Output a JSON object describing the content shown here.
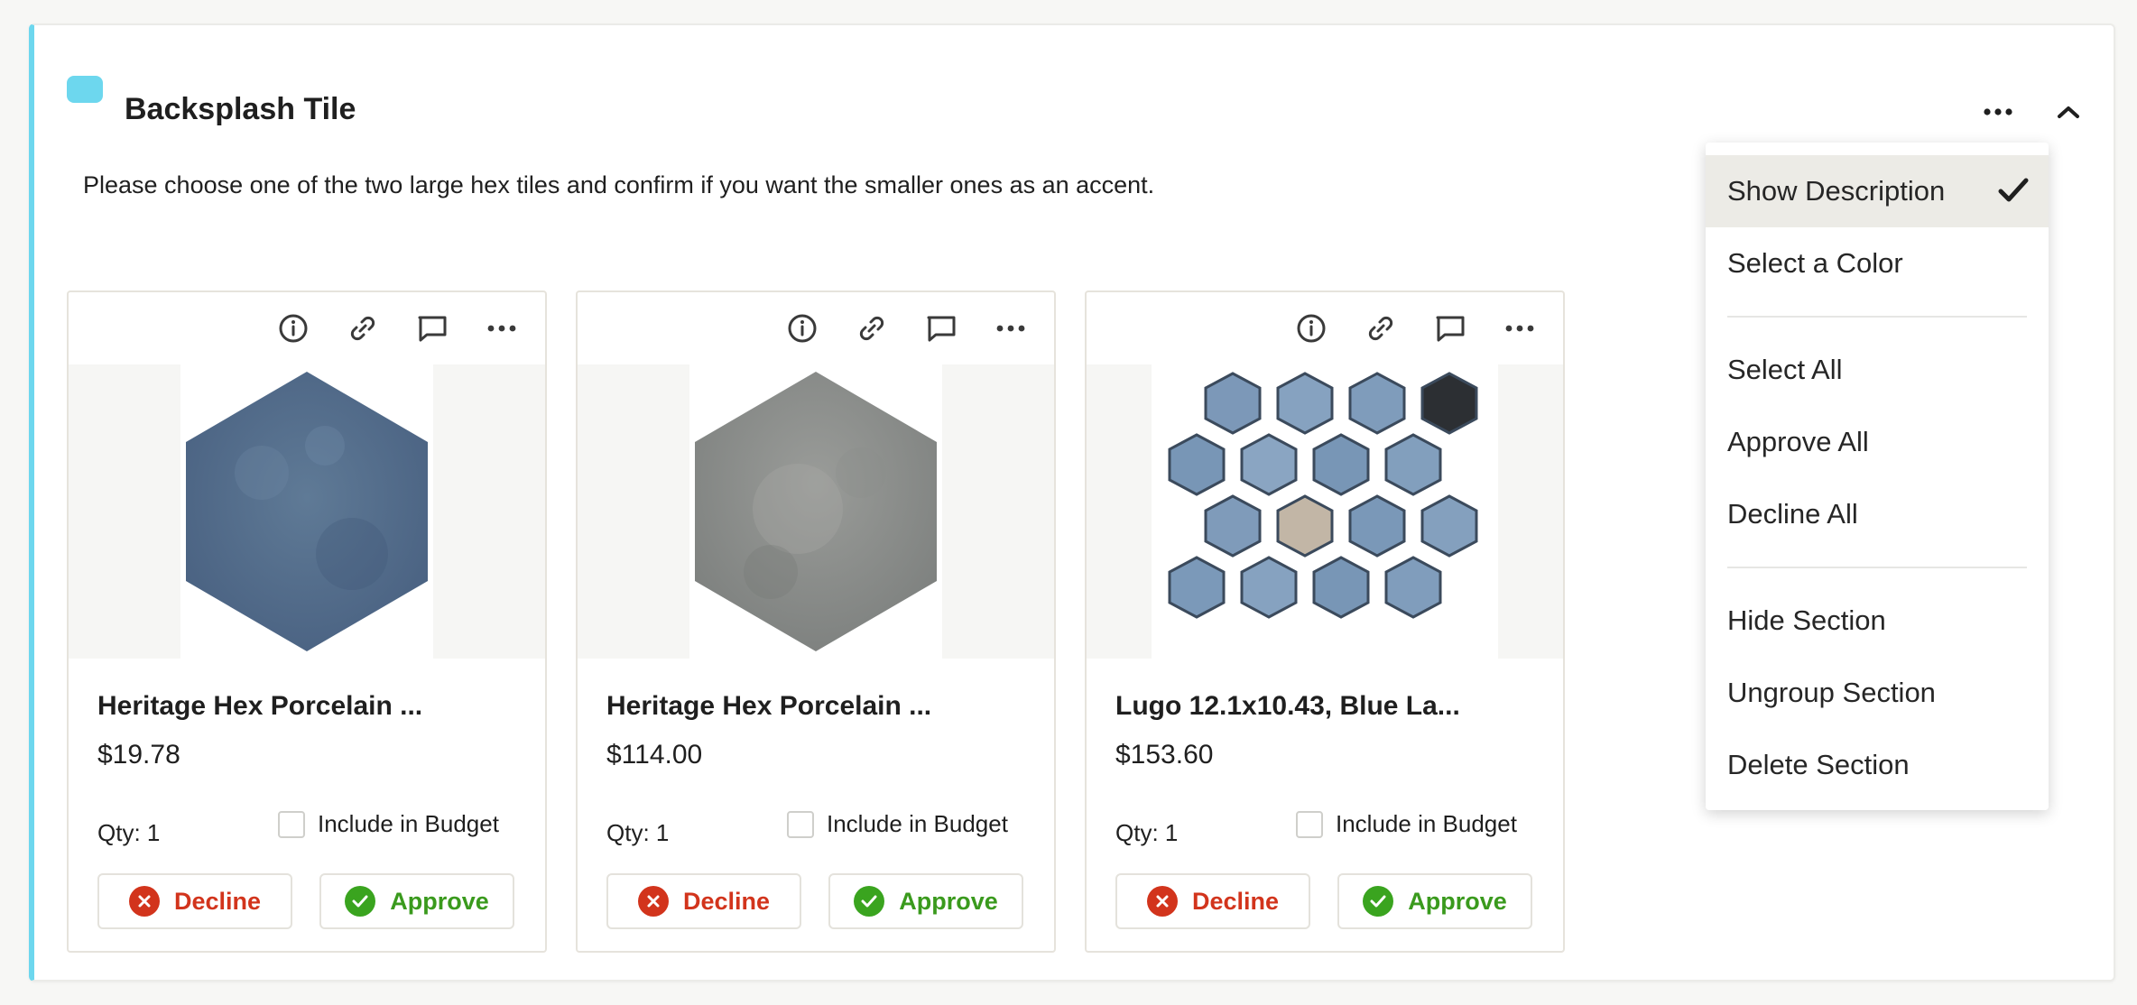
{
  "section": {
    "title": "Backsplash Tile",
    "accent_color": "#6dd7ee",
    "description": "Please choose one of the two large hex tiles and confirm if you want the smaller ones as an accent.",
    "more_icon": "more-horizontal-icon",
    "collapse_icon": "chevron-up-icon"
  },
  "cards": [
    {
      "name": "Heritage Hex Porcelain ...",
      "price": "$19.78",
      "qty": "Qty: 1",
      "budget_label": "Include in Budget",
      "decline_label": "Decline",
      "approve_label": "Approve",
      "image": "blue-hexagon-tile"
    },
    {
      "name": "Heritage Hex Porcelain ...",
      "price": "$114.00",
      "qty": "Qty: 1",
      "budget_label": "Include in Budget",
      "decline_label": "Decline",
      "approve_label": "Approve",
      "image": "gray-hexagon-tile"
    },
    {
      "name": "Lugo 12.1x10.43, Blue La...",
      "price": "$153.60",
      "qty": "Qty: 1",
      "budget_label": "Include in Budget",
      "decline_label": "Decline",
      "approve_label": "Approve",
      "image": "blue-hex-mosaic-tile"
    }
  ],
  "card_toolbar_icons": [
    "info-icon",
    "link-icon",
    "comment-icon",
    "more-horizontal-icon"
  ],
  "menu": {
    "items": [
      {
        "label": "Show Description",
        "checked": true
      },
      {
        "label": "Select a Color"
      },
      {
        "label": "Select All"
      },
      {
        "label": "Approve All"
      },
      {
        "label": "Decline All"
      },
      {
        "label": "Hide Section"
      },
      {
        "label": "Ungroup Section"
      },
      {
        "label": "Delete Section"
      }
    ]
  },
  "colors": {
    "decline": "#d2341c",
    "approve": "#3aa41f",
    "menu_active_bg": "#ecebe6"
  }
}
